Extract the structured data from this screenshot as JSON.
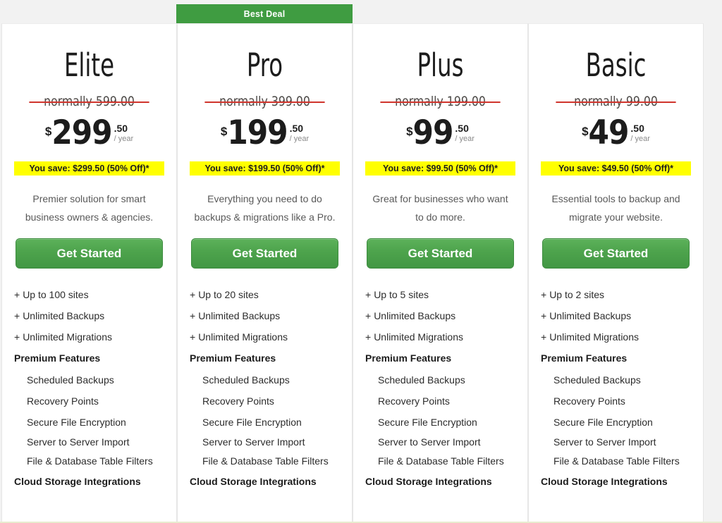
{
  "page": {
    "background_color": "#f2f2f2",
    "accent_green": "#3f9c41",
    "badge_yellow": "#ffff00",
    "strike_red": "#d0342c"
  },
  "ribbon": {
    "label": "Best Deal",
    "on_plan": "Pro"
  },
  "common": {
    "currency_symbol": "$",
    "cents": ".50",
    "period": "/ year",
    "cta_label": "Get Started",
    "premium_features_heading": "Premium Features",
    "cloud_storage_heading": "Cloud Storage Integrations",
    "premium_features": [
      "Scheduled Backups",
      "Recovery Points",
      "Secure File Encryption",
      "Server to Server Import",
      "File & Database Table Filters"
    ]
  },
  "plans": [
    {
      "name": "Elite",
      "normally": "normally 599.00",
      "price_whole": "299",
      "cents": ".50",
      "period": "/ year",
      "savings": "You save: $299.50 (50% Off)*",
      "blurb": "Premier solution for smart business owners & agencies.",
      "cta_label": "Get Started",
      "best_deal": false,
      "top_features": [
        "Up to 100 sites",
        "Unlimited Backups",
        "Unlimited Migrations"
      ]
    },
    {
      "name": "Pro",
      "normally": "normally 399.00",
      "price_whole": "199",
      "cents": ".50",
      "period": "/ year",
      "savings": "You save: $199.50 (50% Off)*",
      "blurb": "Everything you need to do backups & migrations like a Pro.",
      "cta_label": "Get Started",
      "best_deal": true,
      "top_features": [
        "Up to 20 sites",
        "Unlimited Backups",
        "Unlimited Migrations"
      ]
    },
    {
      "name": "Plus",
      "normally": "normally 199.00",
      "price_whole": "99",
      "cents": ".50",
      "period": "/ year",
      "savings": "You save: $99.50 (50% Off)*",
      "blurb": "Great for businesses who want to do more.",
      "cta_label": "Get Started",
      "best_deal": false,
      "top_features": [
        "Up to 5 sites",
        "Unlimited Backups",
        "Unlimited Migrations"
      ]
    },
    {
      "name": "Basic",
      "normally": "normally 99.00",
      "price_whole": "49",
      "cents": ".50",
      "period": "/ year",
      "savings": "You save: $49.50 (50% Off)*",
      "blurb": "Essential tools to backup and migrate your website.",
      "cta_label": "Get Started",
      "best_deal": false,
      "top_features": [
        "Up to 2 sites",
        "Unlimited Backups",
        "Unlimited Migrations"
      ]
    }
  ]
}
